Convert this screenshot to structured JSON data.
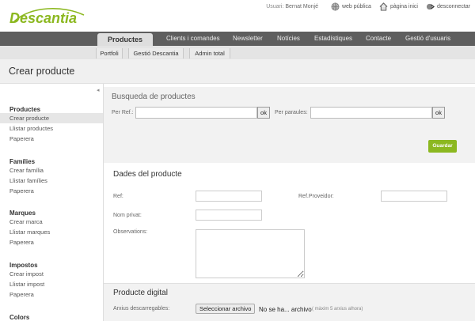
{
  "brand": {
    "logo_text": "Descantia",
    "logo_color": "#8cb820"
  },
  "userbar": {
    "user_label": "Usuari:",
    "user_name": "Bernat Monjé",
    "links": [
      {
        "label": "web pública",
        "icon": "globe-icon"
      },
      {
        "label": "pàgina inici",
        "icon": "home-icon"
      },
      {
        "label": "desconnectar",
        "icon": "logout-icon"
      }
    ]
  },
  "mainnav": {
    "active": "Productes",
    "items": [
      "Clients i comandes",
      "Newsletter",
      "Notícies",
      "Estadístiques",
      "Contacte",
      "Gestió d'usuaris"
    ]
  },
  "subnav": {
    "items": [
      "Portfoli",
      "Gestió Descantia",
      "Admin total"
    ]
  },
  "page": {
    "title": "Crear producte"
  },
  "sidebar": {
    "collapse_glyph": "◂",
    "groups": [
      {
        "title": "Productes",
        "items": [
          "Crear producte",
          "Llistar productes",
          "Paperera"
        ]
      },
      {
        "title": "Famílies",
        "items": [
          "Crear família",
          "Llistar famílies",
          "Paperera"
        ]
      },
      {
        "title": "Marques",
        "items": [
          "Crear marca",
          "Llistar marques",
          "Paperera"
        ]
      },
      {
        "title": "Impostos",
        "items": [
          "Crear impost",
          "Llistar impost",
          "Paperera"
        ]
      },
      {
        "title": "Colors",
        "items": []
      }
    ]
  },
  "search": {
    "title": "Busqueda de productes",
    "ref_label": "Per Ref.:",
    "ref_value": "",
    "words_label": "Per paraules:",
    "words_value": "",
    "ok_label": "ok"
  },
  "save_label": "Guardar",
  "dades": {
    "title": "Dades del producte",
    "ref_label": "Ref:",
    "ref_value": "",
    "ref_prov_label": "Ref.Proveidor:",
    "ref_prov_value": "",
    "nom_label": "Nom privat:",
    "nom_value": "",
    "obs_label": "Observations:",
    "obs_value": ""
  },
  "digital": {
    "title": "Producte digital",
    "files_label": "Arxius descarregables:",
    "select_button": "Seleccionar archivo",
    "file_status": "No se ha... archivo",
    "hint": "( màxim 5 arxius alhora)"
  },
  "colors": {
    "nav_bg": "#5e5e5e",
    "accent": "#8cb820",
    "title_bg": "#f0f0f0"
  }
}
